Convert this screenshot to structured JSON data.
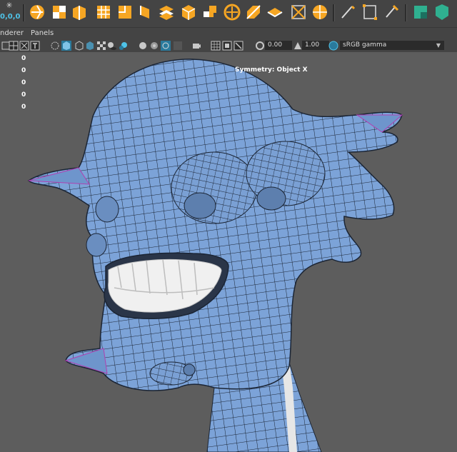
{
  "shelf": {
    "coords_text": "0,0,0",
    "snowflake_icon": "snowflake-icon",
    "tools": [
      "shelf-sphere-icon",
      "shelf-cube-icon",
      "shelf-cylinder-icon",
      "shelf-grid-icon",
      "shelf-plane-icon",
      "shelf-wedge-icon",
      "shelf-sweep-icon",
      "shelf-cube-orange-icon",
      "shelf-multicube-icon",
      "shelf-smooth-icon",
      "shelf-split-icon",
      "shelf-slice-icon",
      "shelf-frame-icon",
      "shelf-soccer-icon",
      "shelf-knife-icon",
      "shelf-select-box-icon",
      "shelf-paint-icon",
      "shelf-green-poly-icon",
      "shelf-green-shape-icon"
    ]
  },
  "menu": {
    "renderer": "nderer",
    "panels": "Panels"
  },
  "view_toolbar": {
    "exposure": "0.00",
    "gamma": "1.00",
    "color_space": "sRGB gamma"
  },
  "hud": {
    "values": [
      "0",
      "0",
      "0",
      "0",
      "0"
    ],
    "symmetry": "Symmetry: Object X"
  },
  "colors": {
    "mesh": "#7ca3d8",
    "teeth": "#f0f0f0",
    "wire": "#1b2535",
    "accent": "#4fc3e8"
  }
}
